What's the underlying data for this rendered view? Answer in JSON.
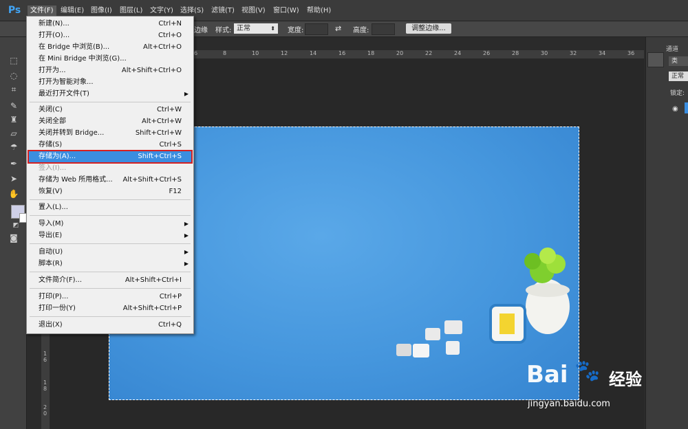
{
  "app": {
    "logo": "Ps"
  },
  "menubar": [
    {
      "label": "文件(F)",
      "active": true
    },
    {
      "label": "编辑(E)"
    },
    {
      "label": "图像(I)"
    },
    {
      "label": "图层(L)"
    },
    {
      "label": "文字(Y)"
    },
    {
      "label": "选择(S)"
    },
    {
      "label": "滤镜(T)"
    },
    {
      "label": "视图(V)"
    },
    {
      "label": "窗口(W)"
    },
    {
      "label": "帮助(H)"
    }
  ],
  "options": {
    "feather_label": "边缘",
    "style_label": "样式:",
    "style_value": "正常",
    "width_label": "宽度:",
    "height_label": "高度:",
    "refine_button": "调整边缘..."
  },
  "ruler_numbers": [
    "6",
    "8",
    "10",
    "12",
    "14",
    "16",
    "18",
    "20",
    "22",
    "24",
    "26",
    "28",
    "30",
    "32",
    "34",
    "36"
  ],
  "vruler_numbers": [
    "1",
    "6",
    "1",
    "8",
    "2",
    "0"
  ],
  "file_menu": {
    "items": [
      {
        "label": "新建(N)...",
        "shortcut": "Ctrl+N"
      },
      {
        "label": "打开(O)...",
        "shortcut": "Ctrl+O"
      },
      {
        "label": "在 Bridge 中浏览(B)...",
        "shortcut": "Alt+Ctrl+O"
      },
      {
        "label": "在 Mini Bridge 中浏览(G)...",
        "shortcut": ""
      },
      {
        "label": "打开为...",
        "shortcut": "Alt+Shift+Ctrl+O"
      },
      {
        "label": "打开为智能对象...",
        "shortcut": ""
      },
      {
        "label": "最近打开文件(T)",
        "shortcut": "",
        "submenu": true
      },
      {
        "label": "关闭(C)",
        "shortcut": "Ctrl+W"
      },
      {
        "label": "关闭全部",
        "shortcut": "Alt+Ctrl+W"
      },
      {
        "label": "关闭并转到 Bridge...",
        "shortcut": "Shift+Ctrl+W"
      },
      {
        "label": "存储(S)",
        "shortcut": "Ctrl+S"
      },
      {
        "label": "存储为(A)...",
        "shortcut": "Shift+Ctrl+S",
        "highlighted": true
      },
      {
        "label": "签入(I)...",
        "shortcut": "",
        "disabled": true
      },
      {
        "label": "存储为 Web 所用格式...",
        "shortcut": "Alt+Shift+Ctrl+S"
      },
      {
        "label": "恢复(V)",
        "shortcut": "F12"
      },
      {
        "label": "置入(L)...",
        "shortcut": ""
      },
      {
        "label": "导入(M)",
        "shortcut": "",
        "submenu": true
      },
      {
        "label": "导出(E)",
        "shortcut": "",
        "submenu": true
      },
      {
        "label": "自动(U)",
        "shortcut": "",
        "submenu": true
      },
      {
        "label": "脚本(R)",
        "shortcut": "",
        "submenu": true
      },
      {
        "label": "文件简介(F)...",
        "shortcut": "Alt+Shift+Ctrl+I"
      },
      {
        "label": "打印(P)...",
        "shortcut": "Ctrl+P"
      },
      {
        "label": "打印一份(Y)",
        "shortcut": "Alt+Shift+Ctrl+P"
      },
      {
        "label": "退出(X)",
        "shortcut": "Ctrl+Q"
      }
    ]
  },
  "right_panel": {
    "tab": "通道",
    "search_placeholder": "类",
    "blend_mode": "正常",
    "lock_label": "锁定:"
  },
  "watermark": {
    "logo": "Bai",
    "logo_suffix": "经验",
    "url": "jingyan.baidu.com"
  },
  "colors": {
    "menu_highlight": "#3b8ee0",
    "red_callout": "#d62020",
    "canvas_blue": "#4596dd"
  }
}
